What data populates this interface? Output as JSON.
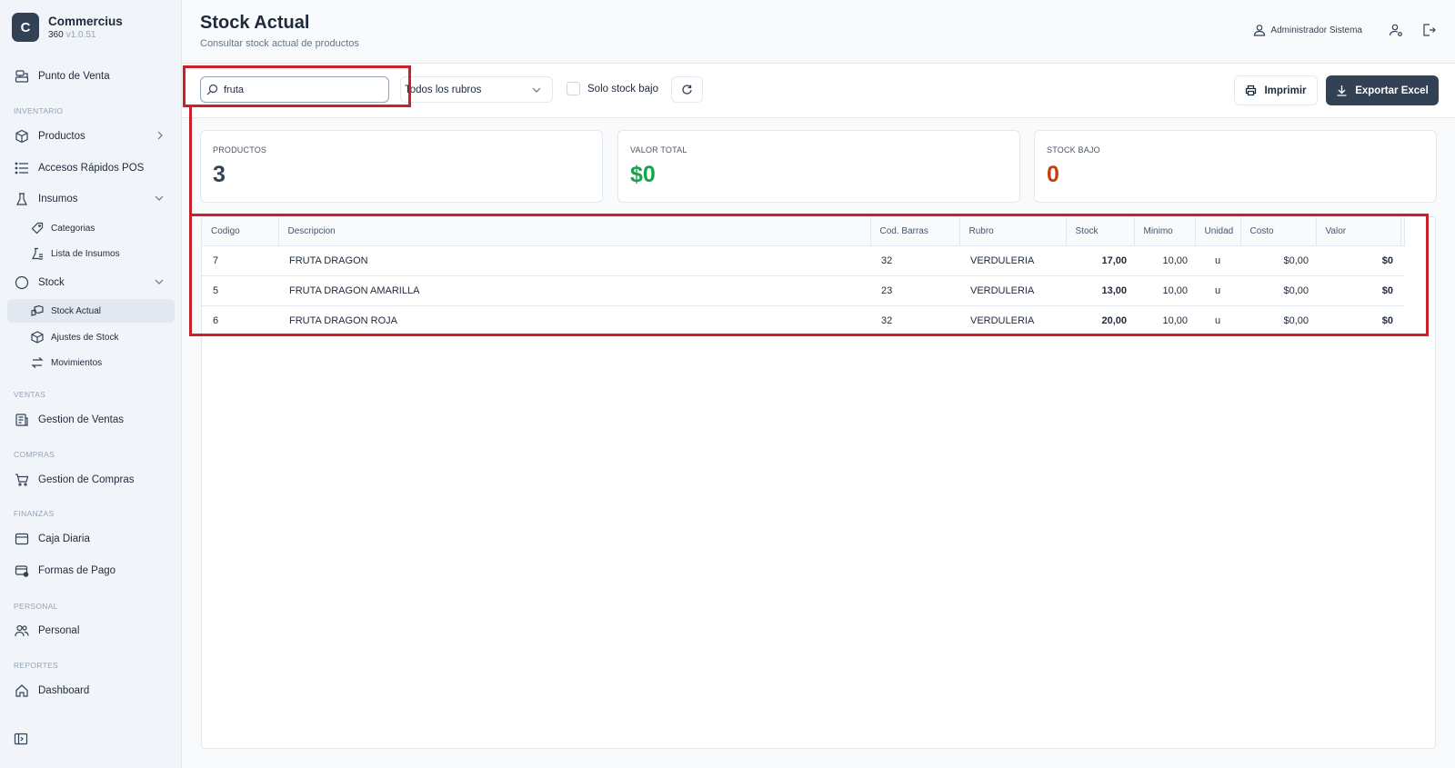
{
  "brand": {
    "logo_letter": "C",
    "name": "Commercius",
    "product": "360",
    "version": "v1.0.51"
  },
  "sidebar": {
    "pos": "Punto de Venta",
    "sections": {
      "inventario": "INVENTARIO",
      "ventas": "VENTAS",
      "compras": "COMPRAS",
      "finanzas": "FINANZAS",
      "personal": "PERSONAL",
      "reportes": "REPORTES"
    },
    "items": {
      "productos": "Productos",
      "accesos": "Accesos Rápidos POS",
      "insumos": "Insumos",
      "categorias": "Categorias",
      "lista_insumos": "Lista de Insumos",
      "stock": "Stock",
      "stock_actual": "Stock Actual",
      "ajustes": "Ajustes de Stock",
      "movimientos": "Movimientos",
      "gestion_ventas": "Gestion de Ventas",
      "gestion_compras": "Gestion de Compras",
      "caja_diaria": "Caja Diaria",
      "formas_pago": "Formas de Pago",
      "personal": "Personal",
      "dashboard": "Dashboard"
    }
  },
  "header": {
    "title": "Stock Actual",
    "subtitle": "Consultar stock actual de productos",
    "user": "Administrador Sistema"
  },
  "toolbar": {
    "search_value": "fruta",
    "rubro_selected": "Todos los rubros",
    "low_stock_label": "Solo stock bajo",
    "print_label": "Imprimir",
    "export_label": "Exportar Excel"
  },
  "stats": {
    "productos": {
      "label": "PRODUCTOS",
      "value": "3"
    },
    "valor_total": {
      "label": "VALOR TOTAL",
      "value": "$0"
    },
    "stock_bajo": {
      "label": "STOCK BAJO",
      "value": "0"
    }
  },
  "colors": {
    "accent": "#334155",
    "green": "#16a34a",
    "orange": "#c2410c",
    "highlight": "#cc1f2a"
  },
  "table": {
    "headers": {
      "codigo": "Codigo",
      "descripcion": "Descripcion",
      "barras": "Cod. Barras",
      "rubro": "Rubro",
      "stock": "Stock",
      "minimo": "Minimo",
      "unidad": "Unidad",
      "costo": "Costo",
      "valor": "Valor"
    },
    "rows": [
      {
        "codigo": "7",
        "descripcion": "FRUTA DRAGON",
        "barras": "32",
        "rubro": "VERDULERIA",
        "stock": "17,00",
        "minimo": "10,00",
        "unidad": "u",
        "costo": "$0,00",
        "valor": "$0"
      },
      {
        "codigo": "5",
        "descripcion": "FRUTA DRAGON AMARILLA",
        "barras": "23",
        "rubro": "VERDULERIA",
        "stock": "13,00",
        "minimo": "10,00",
        "unidad": "u",
        "costo": "$0,00",
        "valor": "$0"
      },
      {
        "codigo": "6",
        "descripcion": "FRUTA DRAGON ROJA",
        "barras": "32",
        "rubro": "VERDULERIA",
        "stock": "20,00",
        "minimo": "10,00",
        "unidad": "u",
        "costo": "$0,00",
        "valor": "$0"
      }
    ]
  }
}
